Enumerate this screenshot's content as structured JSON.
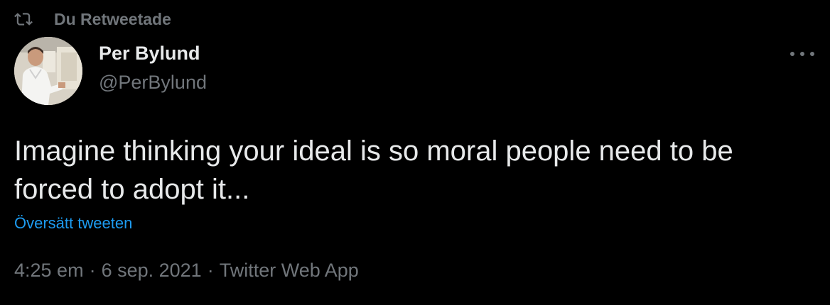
{
  "social_context": {
    "label": "Du Retweetade",
    "icon": "retweet-icon"
  },
  "author": {
    "name": "Per Bylund",
    "handle": "@PerBylund",
    "avatar": "avatar"
  },
  "more_menu": {
    "icon": "more-horizontal-icon"
  },
  "tweet": {
    "text": "Imagine thinking your ideal is so moral people need to be forced to adopt it...",
    "translate_label": "Översätt tweeten"
  },
  "meta": {
    "time": "4:25 em",
    "separator": "·",
    "date": "6 sep. 2021",
    "source": "Twitter Web App"
  },
  "colors": {
    "background": "#000000",
    "primary_text": "#e7e9ea",
    "secondary_text": "#71767b",
    "link": "#1d9bf0"
  }
}
